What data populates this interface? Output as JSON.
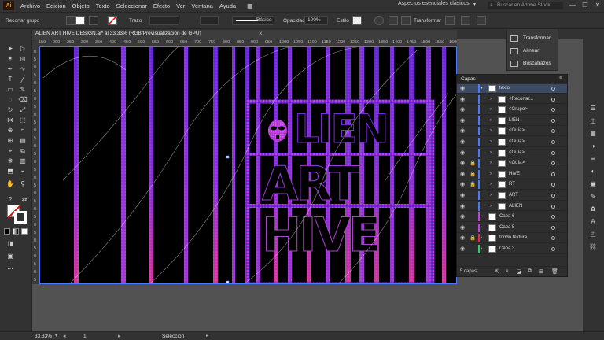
{
  "app": {
    "logo": "Ai"
  },
  "menu": [
    "Archivo",
    "Edición",
    "Objeto",
    "Texto",
    "Seleccionar",
    "Efecto",
    "Ver",
    "Ventana",
    "Ayuda"
  ],
  "workspace": "Aspectos esenciales clásicos",
  "search_placeholder": "Buscar en Adobe Stock",
  "window_controls": [
    "—",
    "❐",
    "✕"
  ],
  "control_bar": {
    "selection_label": "Recortar grupo",
    "stroke_label": "Trazo",
    "brush": "Básico",
    "opacity_label": "Opacidad",
    "opacity_value": "100%",
    "style_label": "Estilo",
    "transform_button": "Transformar"
  },
  "document_tab": {
    "title": "ALIEN ART HIVE DESIGN.ai* al 33.33% (RGB/Previsualización de GPU)",
    "close": "×"
  },
  "rulers": {
    "top": [
      "150",
      "200",
      "250",
      "300",
      "350",
      "400",
      "450",
      "500",
      "550",
      "600",
      "650",
      "700",
      "750",
      "800",
      "850",
      "900",
      "950",
      "1000",
      "1050",
      "1100",
      "1150",
      "1200",
      "1250",
      "1300",
      "1350",
      "1400",
      "1450",
      "1500",
      "1550",
      "1600"
    ],
    "left": [
      "0",
      "5",
      "0",
      "5",
      "0",
      "5",
      "0",
      "5",
      "0",
      "5",
      "0",
      "5",
      "0",
      "5",
      "0",
      "5",
      "0",
      "5",
      "0",
      "5",
      "0",
      "5",
      "0",
      "5",
      "0",
      "5",
      "0",
      "5",
      "0",
      "5"
    ]
  },
  "float_panel": {
    "items": [
      "Transformar",
      "Alinear",
      "Buscatrazos"
    ]
  },
  "layers_panel": {
    "title": "Capas",
    "rows": [
      {
        "name": "texto",
        "color": "#4a7bff",
        "selected": true,
        "expanded": true,
        "indent": 0
      },
      {
        "name": "<Recortar...",
        "color": "#4a7bff",
        "indent": 1
      },
      {
        "name": "<Grupo>",
        "color": "#4a7bff",
        "indent": 1
      },
      {
        "name": "LIEN",
        "color": "#4a7bff",
        "indent": 1
      },
      {
        "name": "<Guía>",
        "color": "#4a7bff",
        "indent": 1
      },
      {
        "name": "<Guía>",
        "color": "#4a7bff",
        "indent": 1
      },
      {
        "name": "<Guía>",
        "color": "#4a7bff",
        "indent": 1
      },
      {
        "name": "<Guía>",
        "color": "#4a7bff",
        "indent": 1
      },
      {
        "name": "HIVE",
        "color": "#4a7bff",
        "indent": 1
      },
      {
        "name": "RT",
        "color": "#4a7bff",
        "indent": 1
      },
      {
        "name": "ART",
        "color": "#4a7bff",
        "indent": 1
      },
      {
        "name": "ALIEN",
        "color": "#4a7bff",
        "indent": 1
      },
      {
        "name": "Capa 6",
        "color": "#c040e0",
        "indent": 0
      },
      {
        "name": "Capa 5",
        "color": "#c040e0",
        "indent": 0
      },
      {
        "name": "fondo textura",
        "color": "#e03050",
        "indent": 0
      },
      {
        "name": "Capa 3",
        "color": "#30d070",
        "indent": 0
      }
    ],
    "footer": "5 capas"
  },
  "canvas_text": {
    "line1_mark": "A",
    "line1": "LIEN",
    "line2": "ART",
    "line3": "HIVE"
  },
  "status": {
    "zoom": "33.33%",
    "artboard": "1",
    "mode": "Selección"
  },
  "colors": {
    "accent": "#4a7bff",
    "purple": "#8a3cff",
    "magenta": "#e040c0",
    "pink": "#ff4080"
  }
}
